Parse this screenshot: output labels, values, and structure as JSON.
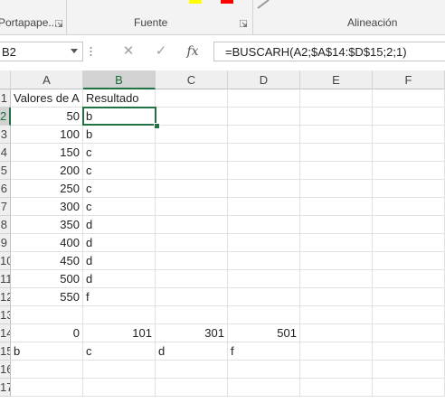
{
  "ribbon": {
    "groups": [
      "Portapape...",
      "Fuente",
      "Alineación"
    ]
  },
  "formula_bar": {
    "name_box": "B2",
    "cancel_icon": "✕",
    "enter_icon": "✓",
    "fx_label": "fx",
    "formula": "=BUSCARH(A2;$A$14:$D$15;2;1)"
  },
  "columns": [
    "A",
    "B",
    "C",
    "D",
    "E",
    "F"
  ],
  "rows": [
    "1",
    "2",
    "3",
    "4",
    "5",
    "6",
    "7",
    "8",
    "9",
    "10",
    "11",
    "12",
    "13",
    "14",
    "15",
    "16",
    "17"
  ],
  "cells": {
    "A1": "Valores de A",
    "B1": "Resultado",
    "A2": "50",
    "B2": "b",
    "A3": "100",
    "B3": "b",
    "A4": "150",
    "B4": "c",
    "A5": "200",
    "B5": "c",
    "A6": "250",
    "B6": "c",
    "A7": "300",
    "B7": "c",
    "A8": "350",
    "B8": "d",
    "A9": "400",
    "B9": "d",
    "A10": "450",
    "B10": "d",
    "A11": "500",
    "B11": "d",
    "A12": "550",
    "B12": "f",
    "A14": "0",
    "B14": "101",
    "C14": "301",
    "D14": "501",
    "A15": "b",
    "B15": "c",
    "C15": "d",
    "D15": "f"
  },
  "selection": {
    "column": "B",
    "row": "2"
  },
  "colors": {
    "accent": "#217346",
    "font_yellow": "#ffff00",
    "font_red": "#ff0000"
  }
}
